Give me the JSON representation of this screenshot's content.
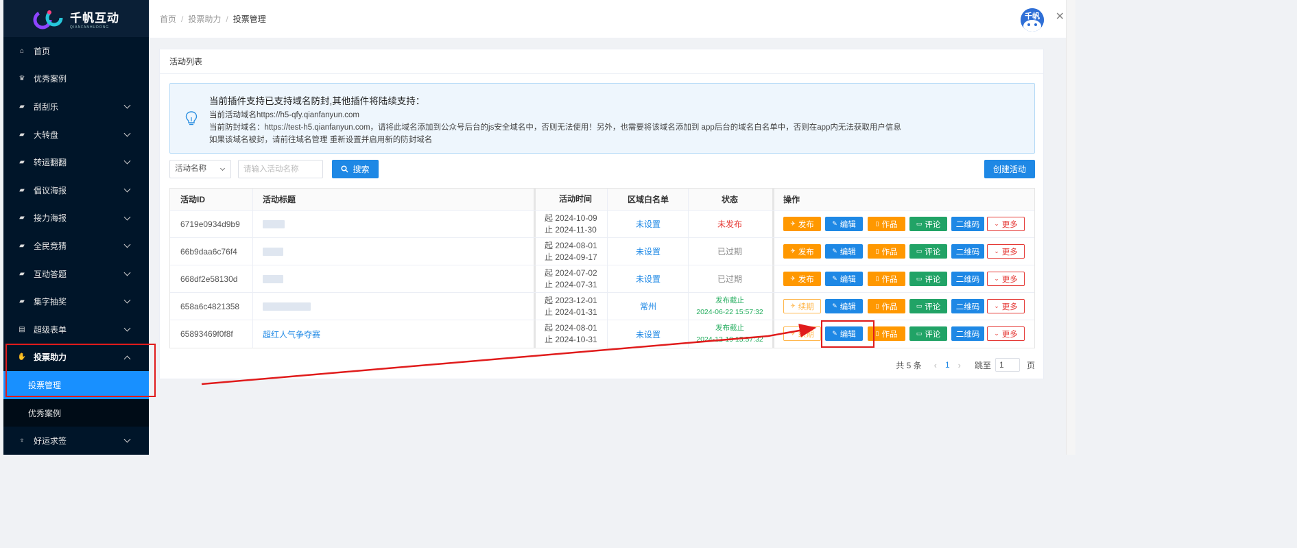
{
  "brand": {
    "name": "千帆互动",
    "sub": "QIANFANHUDONG"
  },
  "sidebar": {
    "items": [
      {
        "label": "首页",
        "icon": "home-icon",
        "has_children": false
      },
      {
        "label": "优秀案例",
        "icon": "trophy-icon",
        "has_children": false
      },
      {
        "label": "刮刮乐",
        "icon": "gamepad-icon",
        "has_children": true
      },
      {
        "label": "大转盘",
        "icon": "gamepad-icon",
        "has_children": true
      },
      {
        "label": "转运翻翻",
        "icon": "gamepad-icon",
        "has_children": true
      },
      {
        "label": "倡议海报",
        "icon": "gamepad-icon",
        "has_children": true
      },
      {
        "label": "接力海报",
        "icon": "gamepad-icon",
        "has_children": true
      },
      {
        "label": "全民竞猜",
        "icon": "gamepad-icon",
        "has_children": true
      },
      {
        "label": "互动答题",
        "icon": "gamepad-icon",
        "has_children": true
      },
      {
        "label": "集字抽奖",
        "icon": "gamepad-icon",
        "has_children": true
      },
      {
        "label": "超级表单",
        "icon": "list-icon",
        "has_children": true
      },
      {
        "label": "投票助力",
        "icon": "hand-icon",
        "has_children": true,
        "open": true
      },
      {
        "label": "好运求签",
        "icon": "lucky-icon",
        "has_children": true
      }
    ],
    "vote_children": [
      {
        "label": "投票管理",
        "active": true
      },
      {
        "label": "优秀案例",
        "active": false
      }
    ]
  },
  "breadcrumb": {
    "home": "首页",
    "parent": "投票助力",
    "current": "投票管理"
  },
  "card": {
    "title": "活动列表"
  },
  "tip": {
    "title": "当前插件支持已支持域名防封,其他插件将陆续支持：",
    "line1": "当前活动域名https://h5-qfy.qianfanyun.com",
    "line2": "当前防封域名：https://test-h5.qianfanyun.com，请将此域名添加到公众号后台的js安全域名中，否则无法使用！另外，也需要将该域名添加到 app后台的域名白名单中，否则在app内无法获取用户信息",
    "line3": "如果该域名被封，请前往域名管理 重新设置并启用新的防封域名"
  },
  "filters": {
    "select_value": "活动名称",
    "search_placeholder": "请输入活动名称",
    "search_button": "搜索",
    "create_button": "创建活动"
  },
  "table": {
    "headers": {
      "id": "活动ID",
      "title": "活动标题",
      "time": "活动时间",
      "whitelist": "区域白名单",
      "status": "状态",
      "ops": "操作"
    },
    "rows": [
      {
        "id": "6719e0934d9b9",
        "title": "",
        "start": "起 2024-10-09",
        "end": "止 2024-11-30",
        "whitelist": "未设置",
        "status": "未发布",
        "status_type": "red",
        "status2": "",
        "first_op": "发布"
      },
      {
        "id": "66b9daa6c76f4",
        "title": "",
        "start": "起 2024-08-01",
        "end": "止 2024-09-17",
        "whitelist": "未设置",
        "status": "已过期",
        "status_type": "gray",
        "status2": "",
        "first_op": "发布"
      },
      {
        "id": "668df2e58130d",
        "title": "",
        "start": "起 2024-07-02",
        "end": "止 2024-07-31",
        "whitelist": "未设置",
        "status": "已过期",
        "status_type": "gray",
        "status2": "",
        "first_op": "发布"
      },
      {
        "id": "658a6c4821358",
        "title": "",
        "start": "起 2023-12-01",
        "end": "止 2024-01-31",
        "whitelist": "常州",
        "status": "发布截止",
        "status_type": "green",
        "status2": "2024-06-22 15:57:32",
        "first_op": "续期"
      },
      {
        "id": "65893469f0f8f",
        "title": "超红人气争夺赛",
        "start": "起 2024-08-01",
        "end": "止 2024-10-31",
        "whitelist": "未设置",
        "status": "发布截止",
        "status_type": "green",
        "status2": "2024-12-19 15:57:32",
        "first_op": "续期"
      }
    ],
    "op_labels": {
      "edit": "编辑",
      "works": "作品",
      "comment": "评论",
      "qrcode": "二维码",
      "more": "更多"
    }
  },
  "pager": {
    "total": "共 5 条",
    "current": "1",
    "jump_label": "跳至",
    "jump_value": "1",
    "page_suffix": "页"
  },
  "colors": {
    "primary": "#1e88e5",
    "sidebar_bg": "#001529",
    "orange": "#ff9800",
    "green": "#21a366",
    "red": "#e53935",
    "annotation": "#e01b1b"
  }
}
